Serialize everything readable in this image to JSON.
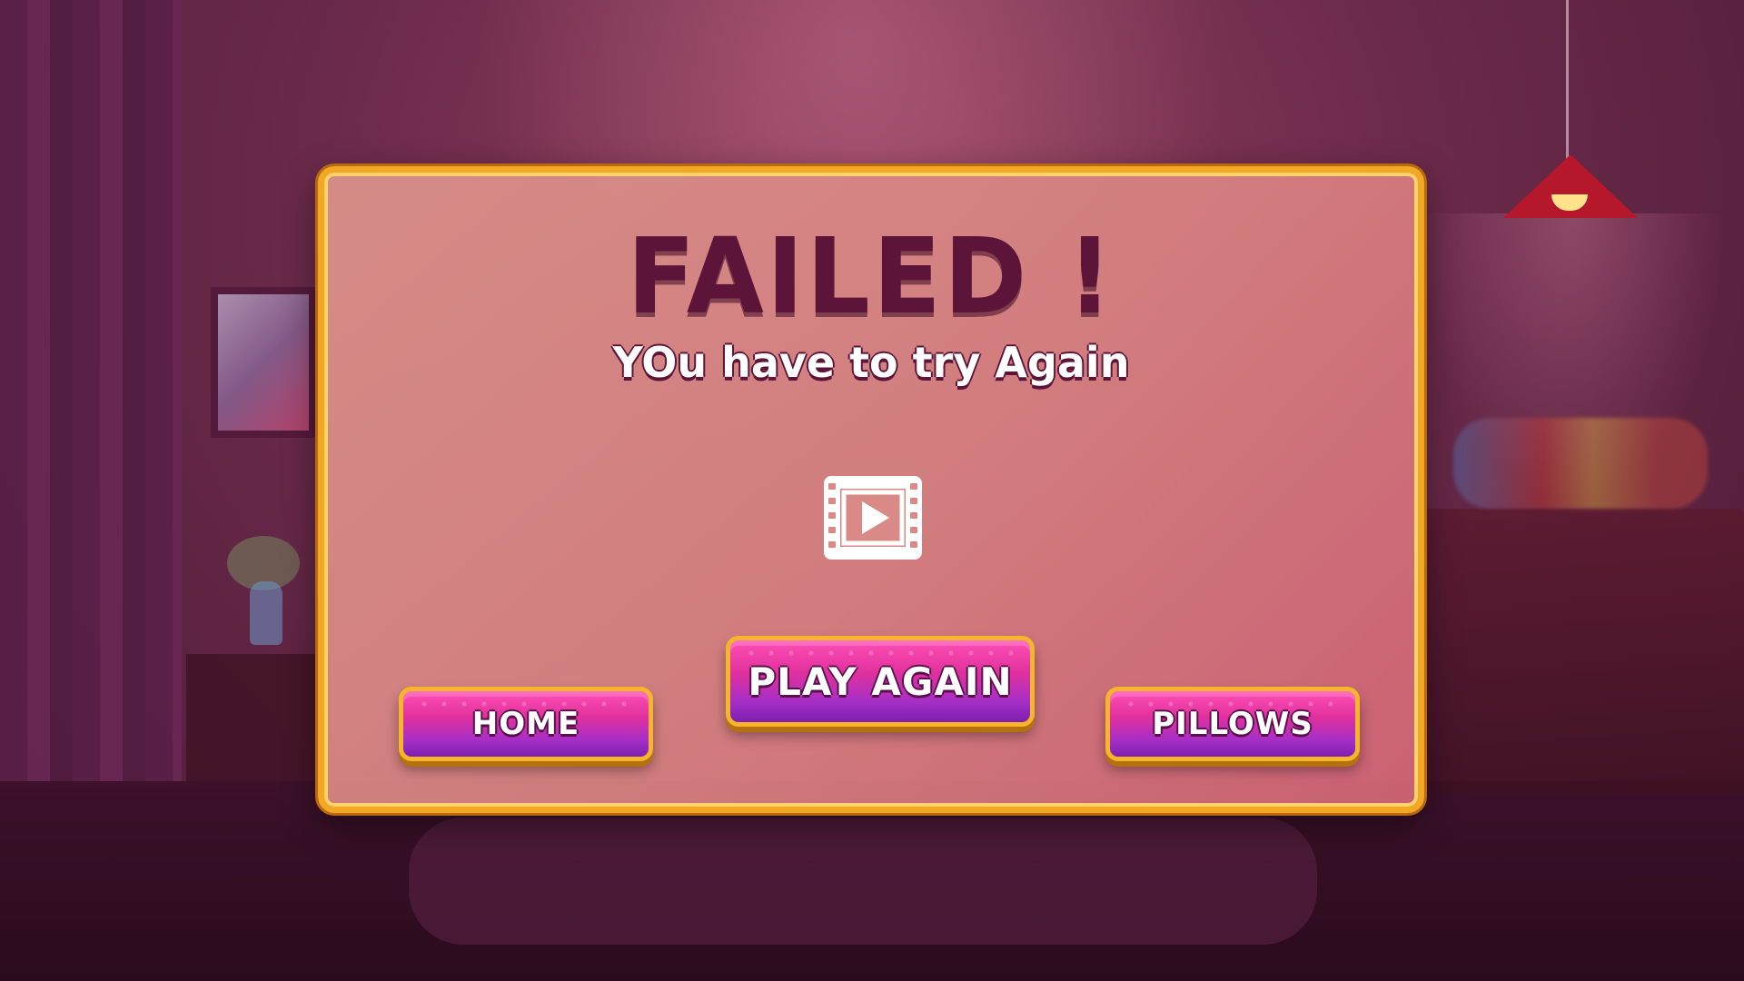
{
  "dialog": {
    "title": "FAILED !",
    "subtitle": "YOu have to try Again",
    "video_icon": "video-play-icon"
  },
  "buttons": {
    "home": "HOME",
    "play_again": "PLAY AGAIN",
    "pillows": "PILLOWS"
  },
  "colors": {
    "panel_border": "#f3a825",
    "title": "#5c1438",
    "button_top": "#ff4fb4",
    "button_bottom": "#7d1fb0"
  }
}
